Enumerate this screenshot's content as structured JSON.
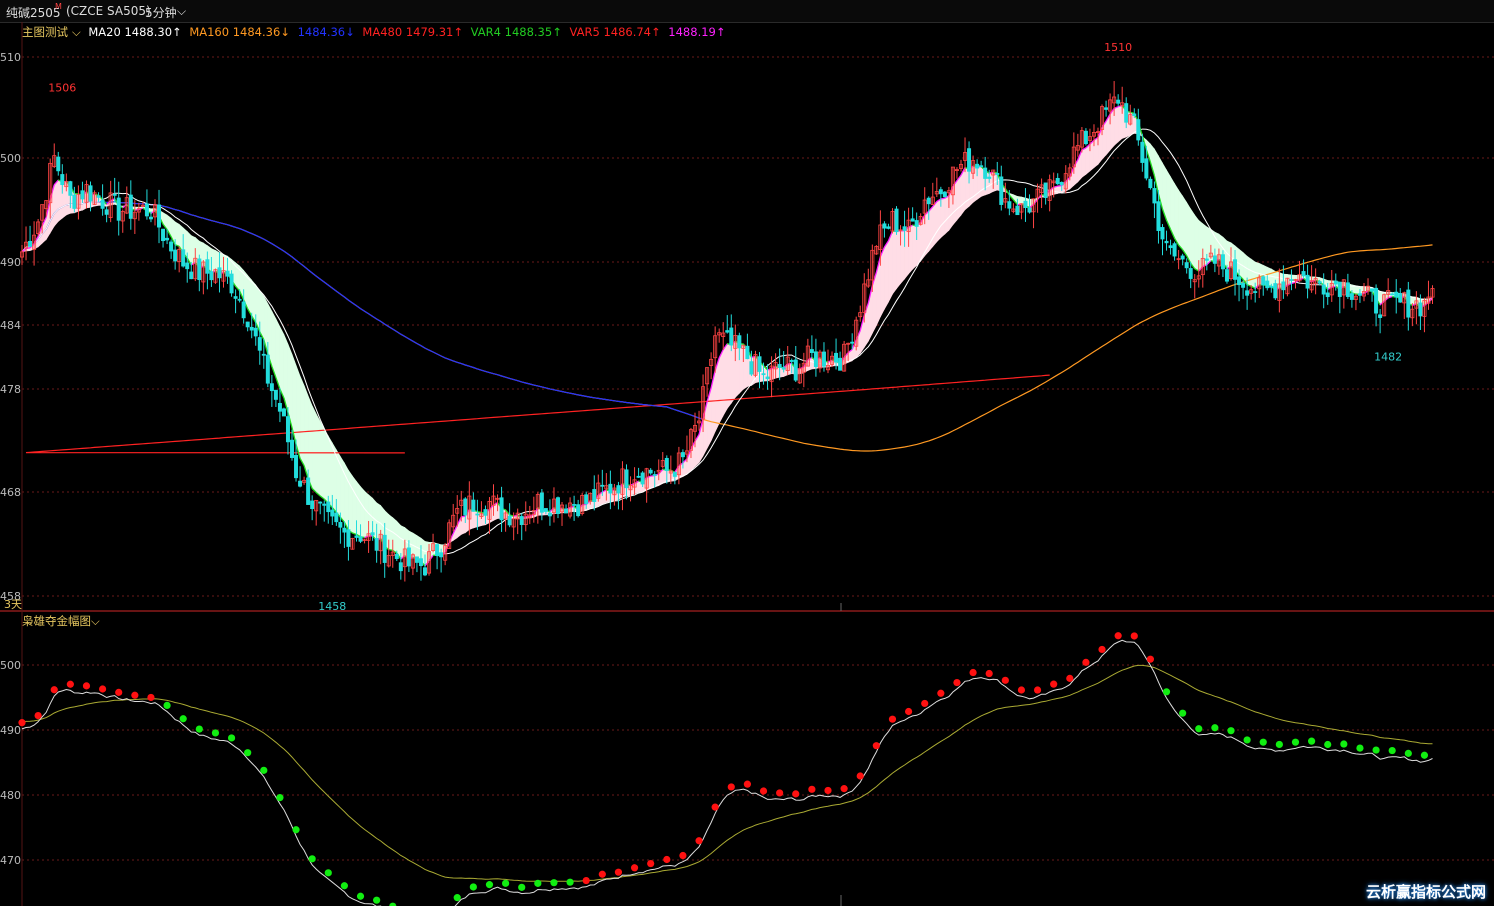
{
  "header": {
    "symbol": "纯碱2505",
    "superscript": "M",
    "code": "(CZCE SA505)",
    "period": "5分钟",
    "period_arrow": "⌵"
  },
  "main_indicator": {
    "name": "主图测试",
    "items": [
      {
        "label": "MA20 1488.30↑",
        "color": "#ffffff"
      },
      {
        "label": "MA160 1484.36↓",
        "color": "#ff9922"
      },
      {
        "label": "1484.36↓",
        "color": "#2233ff"
      },
      {
        "label": "MA480 1479.31↑",
        "color": "#ff2222"
      },
      {
        "label": "VAR4 1488.35↑",
        "color": "#22cc22"
      },
      {
        "label": "VAR5 1486.74↑",
        "color": "#ff2222"
      },
      {
        "label": "1488.19↑",
        "color": "#ff22ff"
      }
    ]
  },
  "sub_indicator": {
    "name": "枭雄夺金幅图"
  },
  "days_label": "3天",
  "watermark": "云析赢指标公式网",
  "chart_data": [
    {
      "type": "candlestick",
      "y_ticks": [
        "510",
        "500",
        "490",
        "484",
        "478",
        "468",
        "458"
      ],
      "y_tick_values": [
        1510,
        1500,
        1490,
        1484,
        1478,
        1468,
        1458
      ],
      "annotations": [
        {
          "text": "1506",
          "color": "#ff3333",
          "x_index": 10,
          "value": 1506
        },
        {
          "text": "1510",
          "color": "#ff3333",
          "x_index": 272,
          "value": 1510
        },
        {
          "text": "1458",
          "color": "#33cccc",
          "x_index": 77,
          "value": 1458
        },
        {
          "text": "1482",
          "color": "#33cccc",
          "x_index": 339,
          "value": 1482
        }
      ],
      "key_closes": [
        [
          0,
          1491
        ],
        [
          4,
          1494
        ],
        [
          8,
          1500
        ],
        [
          12,
          1496
        ],
        [
          16,
          1497
        ],
        [
          20,
          1496
        ],
        [
          24,
          1495
        ],
        [
          28,
          1495
        ],
        [
          32,
          1495
        ],
        [
          36,
          1492
        ],
        [
          40,
          1490
        ],
        [
          44,
          1489
        ],
        [
          48,
          1489
        ],
        [
          52,
          1488
        ],
        [
          56,
          1485
        ],
        [
          60,
          1480
        ],
        [
          64,
          1476
        ],
        [
          68,
          1470
        ],
        [
          72,
          1467
        ],
        [
          76,
          1465
        ],
        [
          80,
          1464
        ],
        [
          84,
          1464
        ],
        [
          88,
          1463
        ],
        [
          92,
          1462
        ],
        [
          96,
          1461
        ],
        [
          100,
          1461
        ],
        [
          104,
          1463
        ],
        [
          108,
          1466
        ],
        [
          112,
          1467
        ],
        [
          116,
          1467
        ],
        [
          120,
          1466
        ],
        [
          124,
          1466
        ],
        [
          128,
          1467
        ],
        [
          132,
          1467
        ],
        [
          136,
          1467
        ],
        [
          140,
          1467
        ],
        [
          144,
          1468
        ],
        [
          148,
          1469
        ],
        [
          152,
          1470
        ],
        [
          156,
          1470
        ],
        [
          160,
          1470
        ],
        [
          164,
          1471
        ],
        [
          168,
          1475
        ],
        [
          172,
          1483
        ],
        [
          176,
          1482
        ],
        [
          180,
          1481
        ],
        [
          184,
          1479
        ],
        [
          188,
          1480
        ],
        [
          192,
          1480
        ],
        [
          196,
          1481
        ],
        [
          200,
          1481
        ],
        [
          204,
          1481
        ],
        [
          208,
          1486
        ],
        [
          212,
          1492
        ],
        [
          216,
          1494
        ],
        [
          220,
          1493
        ],
        [
          224,
          1496
        ],
        [
          228,
          1497
        ],
        [
          232,
          1499
        ],
        [
          236,
          1500
        ],
        [
          240,
          1499
        ],
        [
          244,
          1496
        ],
        [
          248,
          1495
        ],
        [
          252,
          1496
        ],
        [
          256,
          1497
        ],
        [
          260,
          1500
        ],
        [
          264,
          1502
        ],
        [
          268,
          1504
        ],
        [
          272,
          1506
        ],
        [
          276,
          1503
        ],
        [
          280,
          1497
        ],
        [
          284,
          1491
        ],
        [
          288,
          1490
        ],
        [
          292,
          1489
        ],
        [
          296,
          1490
        ],
        [
          300,
          1489
        ],
        [
          304,
          1488
        ],
        [
          308,
          1487
        ],
        [
          312,
          1488
        ],
        [
          316,
          1489
        ],
        [
          320,
          1488
        ],
        [
          324,
          1488
        ],
        [
          328,
          1488
        ],
        [
          332,
          1487
        ],
        [
          336,
          1486
        ],
        [
          340,
          1486
        ],
        [
          344,
          1486
        ],
        [
          348,
          1486
        ],
        [
          350,
          1488
        ]
      ]
    },
    {
      "type": "line",
      "y_ticks": [
        "500",
        "490",
        "480",
        "470"
      ],
      "y_tick_values": [
        1500,
        1490,
        1480,
        1470
      ]
    }
  ]
}
